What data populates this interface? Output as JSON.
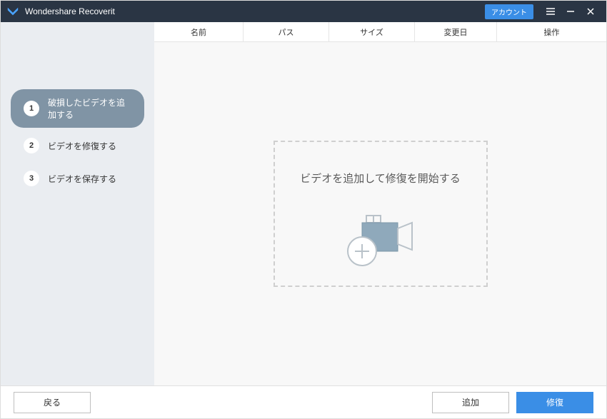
{
  "titlebar": {
    "app_name": "Wondershare Recoverit",
    "account_label": "アカウント"
  },
  "sidebar": {
    "steps": [
      {
        "num": "1",
        "label": "破損したビデオを追加する",
        "active": true
      },
      {
        "num": "2",
        "label": "ビデオを修復する",
        "active": false
      },
      {
        "num": "3",
        "label": "ビデオを保存する",
        "active": false
      }
    ]
  },
  "table": {
    "headers": {
      "name": "名前",
      "path": "パス",
      "size": "サイズ",
      "date": "変更日",
      "op": "操作"
    }
  },
  "drop": {
    "message": "ビデオを追加して修復を開始する"
  },
  "footer": {
    "back": "戻る",
    "add": "追加",
    "repair": "修復"
  }
}
